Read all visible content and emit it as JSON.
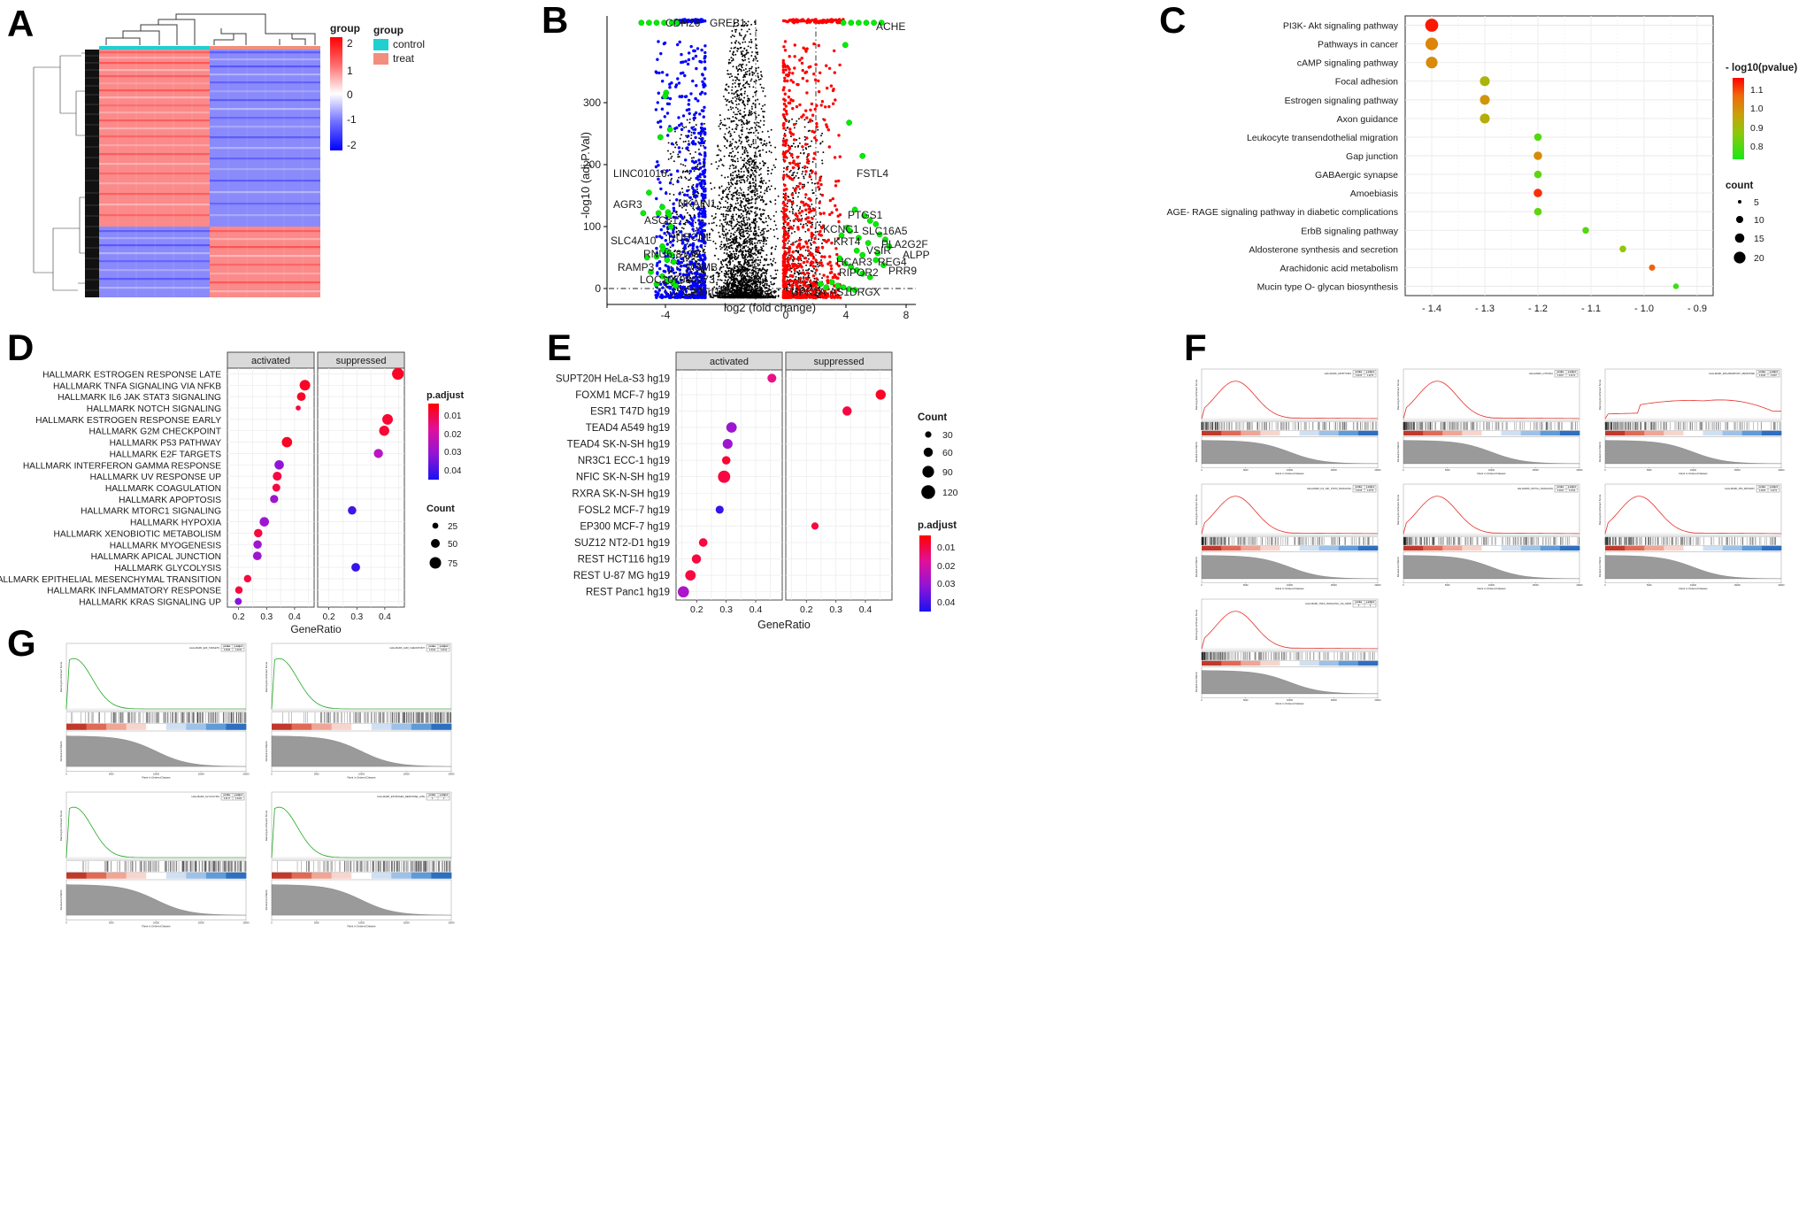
{
  "figure": {
    "panels": [
      "A",
      "B",
      "C",
      "D",
      "E",
      "F",
      "G"
    ]
  },
  "panelA": {
    "label": "A",
    "type": "heatmap",
    "scale_legend_title": "group",
    "scale_ticks": [
      "2",
      "1",
      "0",
      "-1",
      "-2"
    ],
    "group_legend_title": "group",
    "group_items": [
      {
        "label": "control",
        "color": "#20d0d0"
      },
      {
        "label": "treat",
        "color": "#f28e7e"
      }
    ],
    "colors": {
      "high": "#ff0000",
      "mid": "#ffffff",
      "low": "#0000ff"
    },
    "n_control": 6,
    "n_treat": 6
  },
  "panelB": {
    "label": "B",
    "type": "scatter",
    "xlabel": "log2 (fold change)",
    "ylabel": "-log10 (adj.P.Val)",
    "xticks": [
      "-4",
      "0",
      "4",
      "8"
    ],
    "yticks": [
      "0",
      "100",
      "200",
      "300"
    ],
    "xlim": [
      -7.2,
      9.0
    ],
    "ylim": [
      -8,
      330
    ],
    "colors": {
      "up": "#ff0000",
      "down": "#0000ff",
      "ns": "#000000",
      "highlight": "#00ee00"
    },
    "thresholds": {
      "log2fc": 2.0,
      "y": 0
    },
    "labels_left": [
      "CDH26",
      "GREB1",
      "LINC01016",
      "AGR3",
      "NKAIN1",
      "ASCL1",
      "SLC4A10",
      "RUBCNL",
      "RNU6-813P",
      "RAMP3",
      "MSMB",
      "LOC107984273",
      "C20orf197"
    ],
    "labels_right": [
      "ACHE",
      "FSTL4",
      "PTGS1",
      "KCNC1",
      "SLC16A5",
      "KRT4",
      "VSIR",
      "PLA2G2F",
      "HCAR3",
      "REG4",
      "ALPP",
      "RIPOR2",
      "PRR9",
      "UPK1A-AS1",
      "DRGX"
    ]
  },
  "panelC": {
    "label": "C",
    "type": "scatter",
    "xlabel": "",
    "xticks": [
      "- 1.4",
      "- 1.3",
      "- 1.2",
      "- 1.1",
      "- 1.0",
      "- 0.9"
    ],
    "xlim": [
      -1.45,
      -0.87
    ],
    "color_legend_title": "- log10(pvalue)",
    "color_ticks": [
      "1.1",
      "1.0",
      "0.9",
      "0.8"
    ],
    "size_legend_title": "count",
    "size_items": [
      "5",
      "10",
      "15",
      "20"
    ],
    "categories": [
      "PI3K- Akt signaling pathway",
      "Pathways in cancer",
      "cAMP signaling pathway",
      "Focal adhesion",
      "Estrogen signaling pathway",
      "Axon guidance",
      "Leukocyte transendothelial migration",
      "Gap junction",
      "GABAergic synapse",
      "Amoebiasis",
      "AGE- RAGE signaling pathway in diabetic complications",
      "ErbB signaling pathway",
      "Aldosterone synthesis and secretion",
      "Arachidonic acid metabolism",
      "Mucin type O- glycan biosynthesis"
    ],
    "x": [
      -1.4,
      -1.4,
      -1.4,
      -1.3,
      -1.3,
      -1.3,
      -1.2,
      -1.2,
      -1.2,
      -1.2,
      -1.2,
      -1.11,
      -1.04,
      -0.985,
      -0.94
    ],
    "count": [
      21,
      20,
      18,
      14,
      14,
      14,
      9,
      11,
      9,
      11,
      9,
      7,
      7,
      6,
      5
    ],
    "neglog10p": [
      1.15,
      1.0,
      0.99,
      0.9,
      0.97,
      0.92,
      0.8,
      0.99,
      0.81,
      1.12,
      0.81,
      0.8,
      0.86,
      1.06,
      0.78
    ]
  },
  "panelD": {
    "label": "D",
    "type": "scatter",
    "xlabel": "GeneRatio",
    "facets": [
      "activated",
      "suppressed"
    ],
    "xticks": [
      "0.2",
      "0.3",
      "0.4"
    ],
    "xlim": [
      0.16,
      0.47
    ],
    "color_legend_title": "p.adjust",
    "color_ticks": [
      "0.01",
      "0.02",
      "0.03",
      "0.04"
    ],
    "size_legend_title": "Count",
    "size_items": [
      "25",
      "50",
      "75"
    ],
    "categories": [
      "HALLMARK ESTROGEN RESPONSE LATE",
      "HALLMARK TNFA SIGNALING VIA NFKB",
      "HALLMARK IL6 JAK STAT3 SIGNALING",
      "HALLMARK NOTCH SIGNALING",
      "HALLMARK ESTROGEN RESPONSE EARLY",
      "HALLMARK G2M CHECKPOINT",
      "HALLMARK P53 PATHWAY",
      "HALLMARK E2F TARGETS",
      "HALLMARK INTERFERON GAMMA RESPONSE",
      "HALLMARK UV RESPONSE UP",
      "HALLMARK COAGULATION",
      "HALLMARK APOPTOSIS",
      "HALLMARK MTORC1 SIGNALING",
      "HALLMARK HYPOXIA",
      "HALLMARK XENOBIOTIC METABOLISM",
      "HALLMARK MYOGENESIS",
      "HALLMARK APICAL JUNCTION",
      "HALLMARK GLYCOLYSIS",
      "HALLMARK EPITHELIAL MESENCHYMAL TRANSITION",
      "HALLMARK INFLAMMATORY RESPONSE",
      "HALLMARK KRAS SIGNALING UP"
    ],
    "activated": [
      {
        "i": 1,
        "x": 0.437,
        "count": 62,
        "padj": 0.008
      },
      {
        "i": 2,
        "x": 0.424,
        "count": 46,
        "padj": 0.008
      },
      {
        "i": 3,
        "x": 0.413,
        "count": 16,
        "padj": 0.01
      },
      {
        "i": 6,
        "x": 0.373,
        "count": 60,
        "padj": 0.008
      },
      {
        "i": 8,
        "x": 0.345,
        "count": 52,
        "padj": 0.032
      },
      {
        "i": 9,
        "x": 0.338,
        "count": 48,
        "padj": 0.01
      },
      {
        "i": 10,
        "x": 0.335,
        "count": 40,
        "padj": 0.01
      },
      {
        "i": 11,
        "x": 0.327,
        "count": 42,
        "padj": 0.03
      },
      {
        "i": 13,
        "x": 0.292,
        "count": 52,
        "padj": 0.03
      },
      {
        "i": 14,
        "x": 0.27,
        "count": 44,
        "padj": 0.01
      },
      {
        "i": 15,
        "x": 0.268,
        "count": 44,
        "padj": 0.03
      },
      {
        "i": 16,
        "x": 0.267,
        "count": 46,
        "padj": 0.03
      },
      {
        "i": 18,
        "x": 0.232,
        "count": 36,
        "padj": 0.01
      },
      {
        "i": 19,
        "x": 0.201,
        "count": 36,
        "padj": 0.01
      },
      {
        "i": 20,
        "x": 0.199,
        "count": 32,
        "padj": 0.033
      }
    ],
    "suppressed": [
      {
        "i": 0,
        "x": 0.447,
        "count": 72,
        "padj": 0.008
      },
      {
        "i": 4,
        "x": 0.41,
        "count": 62,
        "padj": 0.009
      },
      {
        "i": 5,
        "x": 0.398,
        "count": 58,
        "padj": 0.009
      },
      {
        "i": 7,
        "x": 0.377,
        "count": 50,
        "padj": 0.026
      },
      {
        "i": 12,
        "x": 0.283,
        "count": 44,
        "padj": 0.041
      },
      {
        "i": 17,
        "x": 0.296,
        "count": 46,
        "padj": 0.042
      }
    ]
  },
  "panelE": {
    "label": "E",
    "type": "scatter",
    "xlabel": "GeneRatio",
    "facets": [
      "activated",
      "suppressed"
    ],
    "xticks": [
      "0.2",
      "0.3",
      "0.4"
    ],
    "xlim": [
      0.13,
      0.49
    ],
    "color_legend_title": "p.adjust",
    "color_ticks": [
      "0.01",
      "0.02",
      "0.03",
      "0.04"
    ],
    "size_legend_title": "Count",
    "size_items": [
      "30",
      "60",
      "90",
      "120"
    ],
    "categories": [
      "SUPT20H HeLa-S3 hg19",
      "FOXM1 MCF-7 hg19",
      "ESR1 T47D hg19",
      "TEAD4 A549 hg19",
      "TEAD4 SK-N-SH hg19",
      "NR3C1 ECC-1 hg19",
      "NFIC SK-N-SH hg19",
      "RXRA SK-N-SH hg19",
      "FOSL2 MCF-7 hg19",
      "EP300 MCF-7 hg19",
      "SUZ12 NT2-D1 hg19",
      "REST HCT116 hg19",
      "REST U-87 MG hg19",
      "REST Panc1 hg19"
    ],
    "activated": [
      {
        "i": 0,
        "x": 0.455,
        "count": 60,
        "padj": 0.016
      },
      {
        "i": 3,
        "x": 0.318,
        "count": 78,
        "padj": 0.03
      },
      {
        "i": 4,
        "x": 0.305,
        "count": 72,
        "padj": 0.03
      },
      {
        "i": 5,
        "x": 0.3,
        "count": 54,
        "padj": 0.009
      },
      {
        "i": 6,
        "x": 0.293,
        "count": 100,
        "padj": 0.01
      },
      {
        "i": 8,
        "x": 0.278,
        "count": 50,
        "padj": 0.042
      },
      {
        "i": 10,
        "x": 0.222,
        "count": 56,
        "padj": 0.01
      },
      {
        "i": 11,
        "x": 0.199,
        "count": 64,
        "padj": 0.01
      },
      {
        "i": 12,
        "x": 0.179,
        "count": 78,
        "padj": 0.01
      },
      {
        "i": 13,
        "x": 0.155,
        "count": 88,
        "padj": 0.028
      }
    ],
    "suppressed": [
      {
        "i": 1,
        "x": 0.452,
        "count": 74,
        "padj": 0.008
      },
      {
        "i": 2,
        "x": 0.338,
        "count": 64,
        "padj": 0.01
      },
      {
        "i": 9,
        "x": 0.229,
        "count": 40,
        "padj": 0.01
      }
    ]
  },
  "panelF": {
    "label": "F",
    "type": "gsea-grid",
    "curve_color": "#e8302a",
    "ylabel_top": "Running Enrichment Score",
    "ylabel_bottom": "Ranked List Metric",
    "xlabel": "Rank in Ordered Dataset",
    "table_headers": [
      "pvalue",
      "p.adjust"
    ],
    "plots": [
      {
        "set": "HALLMARK_APOPTOSIS",
        "pvalue": "0.0015",
        "padjust": "0.0276"
      },
      {
        "set": "HALLMARK_HYPOXIA",
        "pvalue": "0.0007",
        "padjust": "0.0272"
      },
      {
        "set": "HALLMARK_INFLAMMATORY_RESPONSE",
        "pvalue": "0.0036",
        "padjust": "0.0307"
      },
      {
        "set": "HALLMARK_IL6_JAK_STAT3_SIGNALING",
        "pvalue": "0.0015",
        "padjust": "0.0276"
      },
      {
        "set": "HALLMARK_NOTCH_SIGNALING",
        "pvalue": "0.0021",
        "padjust": "0.0316"
      },
      {
        "set": "HALLMARK_P53_PATHWAY",
        "pvalue": "0.0005",
        "padjust": "0.0272"
      },
      {
        "set": "HALLMARK_TNFA_SIGNALING_VIA_NFKB",
        "pvalue": "0",
        "padjust": "0"
      }
    ]
  },
  "panelG": {
    "label": "G",
    "type": "gsea-grid",
    "curve_color": "#1fa81f",
    "ylabel_top": "Running Enrichment Score",
    "ylabel_bottom": "Ranked List Metric",
    "xlabel": "Rank in Ordered Dataset",
    "table_headers": [
      "pvalue",
      "p.adjust"
    ],
    "plots": [
      {
        "set": "HALLMARK_E2F_TARGETS",
        "pvalue": "0.0009",
        "padjust": "0.0232"
      },
      {
        "set": "HALLMARK_G2M_CHECKPOINT",
        "pvalue": "0.0044",
        "padjust": "0.0192"
      },
      {
        "set": "HALLMARK_GLYCOLYSIS",
        "pvalue": "0.0177",
        "padjust": "0.0422"
      },
      {
        "set": "HALLMARK_ESTROGEN_RESPONSE_LATE",
        "pvalue": "0",
        "padjust": "0"
      }
    ]
  }
}
